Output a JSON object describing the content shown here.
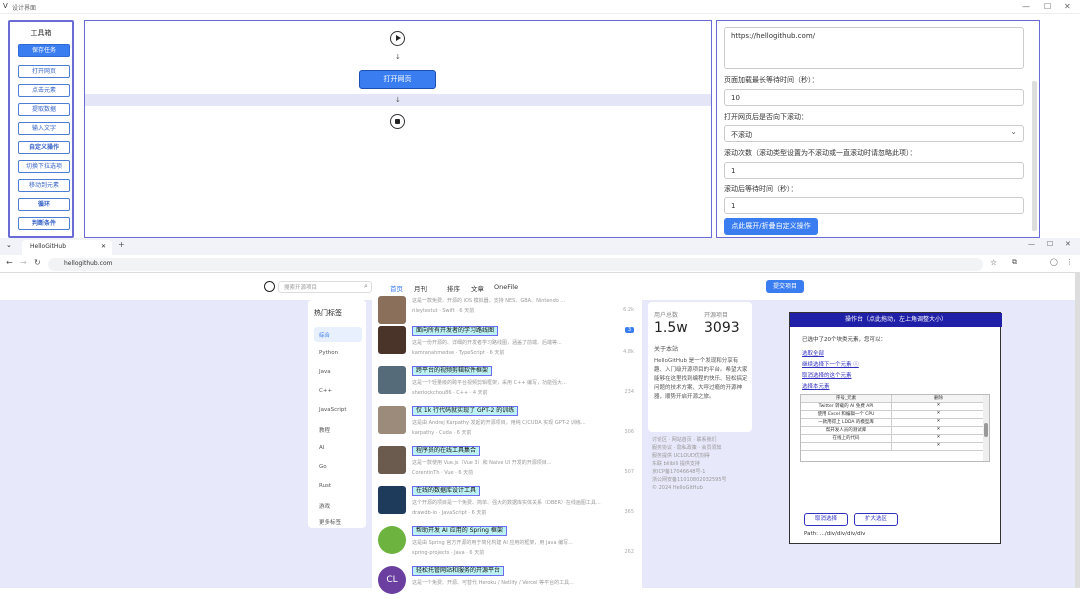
{
  "app": {
    "title": "设计界面",
    "logo": "V"
  },
  "toolbox": {
    "heading": "工具箱",
    "buttons": [
      "保存任务",
      "打开网页",
      "点击元素",
      "提取数据",
      "输入文字",
      "自定义操作",
      "切换下拉选项",
      "移动到元素",
      "循环",
      "判断条件"
    ]
  },
  "flow": {
    "open_page": "打开网页"
  },
  "props": {
    "url_value": "https://hellogithub.com/",
    "max_wait_label": "页面加载最长等待时间（秒）：",
    "max_wait_value": "10",
    "scroll_label": "打开网页后是否向下滚动：",
    "scroll_value": "不滚动",
    "scroll_times_label": "滚动次数（滚动类型设置为不滚动或一直滚动时请忽略此项）：",
    "scroll_times_value": "1",
    "after_wait_label": "滚动后等待时间（秒）：",
    "after_wait_value": "1",
    "fold_button": "点此展开/折叠自定义操作"
  },
  "browser": {
    "tab_title": "HelloGitHub",
    "url": "hellogithub.com",
    "search_placeholder": "搜索开源项目",
    "nav": [
      "首页",
      "月刊",
      "排序",
      "文章",
      "OneFile"
    ],
    "submit": "提交项目",
    "sidebar": {
      "heading": "热门标签",
      "items": [
        "综合",
        "Python",
        "Java",
        "C++",
        "JavaScript",
        "教程",
        "AI",
        "Go",
        "Rust",
        "游戏",
        "更多标签"
      ]
    },
    "feed": [
      {
        "title": "",
        "desc": "这是一款免费、开源的 iOS 模拟器，支持 NES、GBA、Nintendo ...",
        "meta": "rileytestut · Swift · 6 天前",
        "count": "6.2k",
        "color": "#8a6f5b"
      },
      {
        "title": "面向所有开发者的学习路线图",
        "desc": "这是一份开源的、详细的开发者学习路线图，涵盖了前端、后端等...",
        "meta": "kamranahmedse · TypeScript · 6 天前",
        "count": "4.8k",
        "badge": "3",
        "color": "#4a3328"
      },
      {
        "title": "跨平台的视频剪辑软件框架",
        "desc": "这是一个轻量级的跨平台视频剪辑框架，采用 C++ 编写，功能强大...",
        "meta": "sherlockchou86 · C++ · 4 天前",
        "count": "234",
        "color": "#556b7a"
      },
      {
        "title": "仅 1k 行代码就实现了 GPT-2 的训练",
        "desc": "这是由 Andrej Karpathy 发起的开源项目，用纯 C/CUDA 实现 GPT-2 训练...",
        "meta": "karpathy · Cuda · 6 天前",
        "count": "306",
        "color": "#9c8a7a"
      },
      {
        "title": "程序员的在线工具集合",
        "desc": "这是一款使用 Vue.js（Vue 3）和 Naive UI 开发的开源项目...",
        "meta": "CorentinTh · Vue · 6 天前",
        "count": "507",
        "color": "#6b5a4e"
      },
      {
        "title": "在线的数据库设计工具",
        "desc": "这个开源的项目是一个免费、简单、强大的数据库实体关系（DBER）在线画图工具...",
        "meta": "drawdb-io · JavaScript · 6 天前",
        "count": "365",
        "color": "#1f3b5c"
      },
      {
        "title": "帮助开发 AI 应用的 Spring 框架",
        "desc": "这是由 Spring 官方开源的用于简化构建 AI 应用的框架，用 Java 编写...",
        "meta": "spring-projects · Java · 6 天前",
        "count": "262",
        "color": "#6db33f"
      },
      {
        "title": "轻松托管网站和服务的开源平台",
        "desc": "这是一个免费、开源、可替代 Heroku / Netlify / Vercel 等平台的工具...",
        "meta": "",
        "count": "",
        "color": "#6b3fa0",
        "initials": "CL"
      }
    ],
    "stats": {
      "users_label": "用户总数",
      "users_value": "1.5w",
      "projects_label": "开源项目",
      "projects_value": "3093",
      "about_heading": "关于本站",
      "about_text": "HelloGitHub 是一个发现和分享有趣、入门级开源项目的平台。希望大家能够在这里找到编程的快乐、轻松搞定问题的技术方案、大呼过瘾的开源神器，顺势开启开源之旅。"
    },
    "footer": [
      "讨论区 · 网站首页 · 联系我们",
      "服务协议 · 隐私政策 · 会员须知",
      "服务提供 UCLOUD优刻得",
      "东联 bilibili 提供支持",
      "京ICP备17046648号-1",
      "浙公网安备11010802032595号",
      "© 2024 HelloGitHub"
    ]
  },
  "dialog": {
    "header": "操作台（点此拖动，左上角调整大小）",
    "subtitle": "已选中了20个块类元素，您可以：",
    "links": [
      "选取全部",
      "继续选择下一个元素 ⓘ",
      "取消选择的这个元素",
      "选择本元素"
    ],
    "table_headers": [
      "序号_元素",
      "删除"
    ],
    "rows": [
      [
        "Twitter 转载的 AI 免费 API",
        "✕"
      ],
      [
        "使用 Excel 和编辑一个 CPU",
        "✕"
      ],
      [
        "一款用得上 LDDA 的模型库",
        "✕"
      ],
      [
        "帮开发人员的测试库",
        "✕"
      ],
      [
        "在线上的代码",
        "✕"
      ],
      [
        "",
        "✕"
      ]
    ],
    "btn_left": "取消选择",
    "btn_right": "扩大选区",
    "path": "Path: .../div/div/div/div"
  }
}
